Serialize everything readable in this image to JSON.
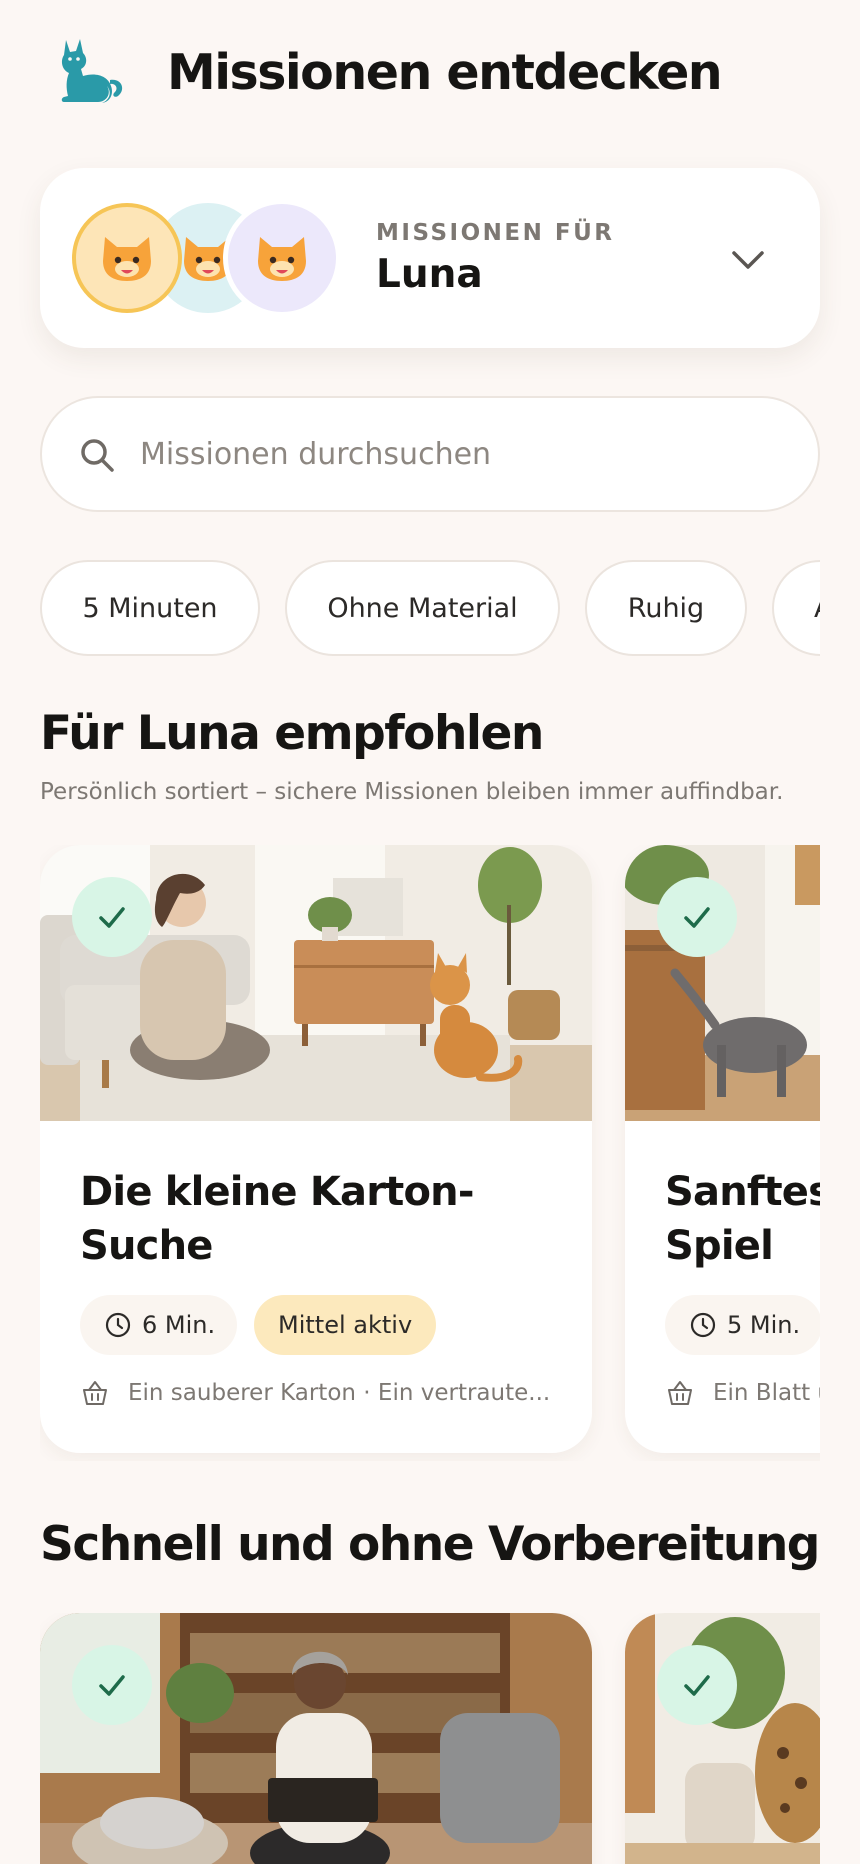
{
  "header": {
    "title": "Missionen entdecken",
    "logo_icon": "cat-logo-icon"
  },
  "selector": {
    "label": "MISSIONEN FÜR",
    "name": "Luna",
    "avatars": [
      "cat-face-icon",
      "cat-face-icon",
      "cat-face-icon"
    ],
    "chevron_icon": "chevron-down-icon"
  },
  "search": {
    "placeholder": "Missionen durchsuchen",
    "value": ""
  },
  "chips": [
    "5 Minuten",
    "Ohne Material",
    "Ruhig",
    "A"
  ],
  "recommended": {
    "title": "Für Luna empfohlen",
    "subtitle": "Persönlich sortiert – sichere Missionen bleiben immer auffindbar.",
    "cards": [
      {
        "title": "Die kleine Karton-Suche",
        "duration": "6 Min.",
        "level": "Mittel aktiv",
        "materials": "Ein sauberer Karton · Ein vertraute..."
      },
      {
        "title": "Sanftes Spiel",
        "duration": "5 Min.",
        "materials": "Ein Blatt u"
      }
    ]
  },
  "quick": {
    "title": "Schnell und ohne Vorbereitung"
  },
  "colors": {
    "accent_teal": "#2a9aa8",
    "check_bg": "#d8f5e6",
    "level_bg": "#fce9bd",
    "avatar_ring": "#f6c556"
  }
}
